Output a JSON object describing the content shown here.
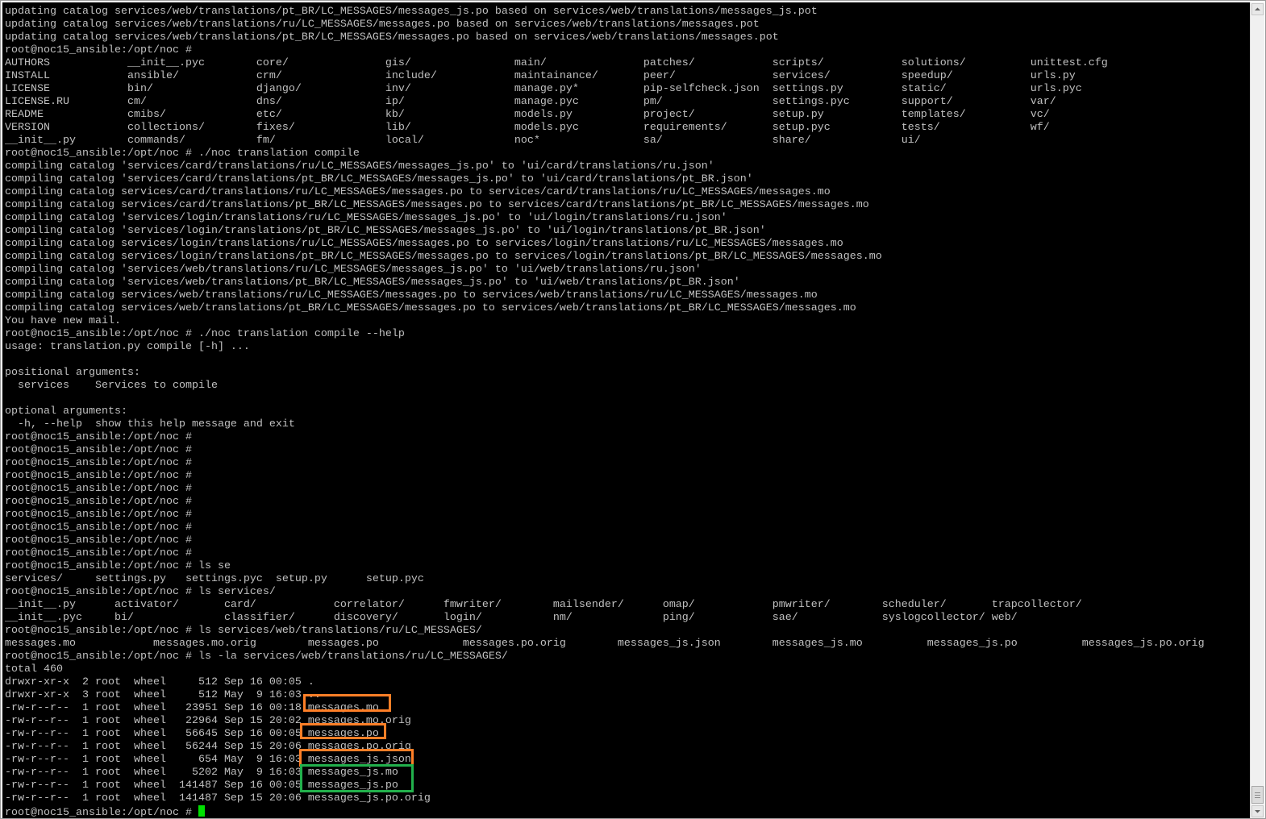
{
  "terminal": {
    "lines": [
      "updating catalog services/web/translations/pt_BR/LC_MESSAGES/messages_js.po based on services/web/translations/messages_js.pot",
      "updating catalog services/web/translations/ru/LC_MESSAGES/messages.po based on services/web/translations/messages.pot",
      "updating catalog services/web/translations/pt_BR/LC_MESSAGES/messages.po based on services/web/translations/messages.pot",
      "root@noc15_ansible:/opt/noc #",
      "AUTHORS            __init__.pyc        core/               gis/                main/               patches/            scripts/            solutions/          unittest.cfg",
      "INSTALL            ansible/            crm/                include/            maintainance/       peer/               services/           speedup/            urls.py",
      "LICENSE            bin/                django/             inv/                manage.py*          pip-selfcheck.json  settings.py         static/             urls.pyc",
      "LICENSE.RU         cm/                 dns/                ip/                 manage.pyc          pm/                 settings.pyc        support/            var/",
      "README             cmibs/              etc/                kb/                 models.py           project/            setup.py            templates/          vc/",
      "VERSION            collections/        fixes/              lib/                models.pyc          requirements/       setup.pyc           tests/              wf/",
      "__init__.py        commands/           fm/                 local/              noc*                sa/                 share/              ui/",
      "root@noc15_ansible:/opt/noc # ./noc translation compile",
      "compiling catalog 'services/card/translations/ru/LC_MESSAGES/messages_js.po' to 'ui/card/translations/ru.json'",
      "compiling catalog 'services/card/translations/pt_BR/LC_MESSAGES/messages_js.po' to 'ui/card/translations/pt_BR.json'",
      "compiling catalog services/card/translations/ru/LC_MESSAGES/messages.po to services/card/translations/ru/LC_MESSAGES/messages.mo",
      "compiling catalog services/card/translations/pt_BR/LC_MESSAGES/messages.po to services/card/translations/pt_BR/LC_MESSAGES/messages.mo",
      "compiling catalog 'services/login/translations/ru/LC_MESSAGES/messages_js.po' to 'ui/login/translations/ru.json'",
      "compiling catalog 'services/login/translations/pt_BR/LC_MESSAGES/messages_js.po' to 'ui/login/translations/pt_BR.json'",
      "compiling catalog services/login/translations/ru/LC_MESSAGES/messages.po to services/login/translations/ru/LC_MESSAGES/messages.mo",
      "compiling catalog services/login/translations/pt_BR/LC_MESSAGES/messages.po to services/login/translations/pt_BR/LC_MESSAGES/messages.mo",
      "compiling catalog 'services/web/translations/ru/LC_MESSAGES/messages_js.po' to 'ui/web/translations/ru.json'",
      "compiling catalog 'services/web/translations/pt_BR/LC_MESSAGES/messages_js.po' to 'ui/web/translations/pt_BR.json'",
      "compiling catalog services/web/translations/ru/LC_MESSAGES/messages.po to services/web/translations/ru/LC_MESSAGES/messages.mo",
      "compiling catalog services/web/translations/pt_BR/LC_MESSAGES/messages.po to services/web/translations/pt_BR/LC_MESSAGES/messages.mo",
      "You have new mail.",
      "root@noc15_ansible:/opt/noc # ./noc translation compile --help",
      "usage: translation.py compile [-h] ...",
      "",
      "positional arguments:",
      "  services    Services to compile",
      "",
      "optional arguments:",
      "  -h, --help  show this help message and exit",
      "root@noc15_ansible:/opt/noc #",
      "root@noc15_ansible:/opt/noc #",
      "root@noc15_ansible:/opt/noc #",
      "root@noc15_ansible:/opt/noc #",
      "root@noc15_ansible:/opt/noc #",
      "root@noc15_ansible:/opt/noc #",
      "root@noc15_ansible:/opt/noc #",
      "root@noc15_ansible:/opt/noc #",
      "root@noc15_ansible:/opt/noc #",
      "root@noc15_ansible:/opt/noc #",
      "root@noc15_ansible:/opt/noc # ls se",
      "services/     settings.py   settings.pyc  setup.py      setup.pyc",
      "root@noc15_ansible:/opt/noc # ls services/",
      "__init__.py      activator/       card/            correlator/      fmwriter/        mailsender/      omap/            pmwriter/        scheduler/       trapcollector/",
      "__init__.pyc     bi/              classifier/      discovery/       login/           nm/              ping/            sae/             syslogcollector/ web/",
      "root@noc15_ansible:/opt/noc # ls services/web/translations/ru/LC_MESSAGES/",
      "messages.mo            messages.mo.orig        messages.po             messages.po.orig        messages_js.json        messages_js.mo          messages_js.po          messages_js.po.orig",
      "root@noc15_ansible:/opt/noc # ls -la services/web/translations/ru/LC_MESSAGES/",
      "total 460",
      "drwxr-xr-x  2 root  wheel     512 Sep 16 00:05 .",
      "drwxr-xr-x  3 root  wheel     512 May  9 16:03 ..",
      "-rw-r--r--  1 root  wheel   23951 Sep 16 00:18 messages.mo",
      "-rw-r--r--  1 root  wheel   22964 Sep 15 20:02 messages.mo.orig",
      "-rw-r--r--  1 root  wheel   56645 Sep 16 00:05 messages.po",
      "-rw-r--r--  1 root  wheel   56244 Sep 15 20:06 messages.po.orig",
      "-rw-r--r--  1 root  wheel     654 May  9 16:03 messages_js.json",
      "-rw-r--r--  1 root  wheel    5202 May  9 16:03 messages_js.mo",
      "-rw-r--r--  1 root  wheel  141487 Sep 16 00:05 messages_js.po",
      "-rw-r--r--  1 root  wheel  141487 Sep 15 20:06 messages_js.po.orig"
    ],
    "prompt": "root@noc15_ansible:/opt/noc # "
  },
  "colors": {
    "background": "#000000",
    "foreground": "#c0c0c0",
    "cursor": "#00e000",
    "highlight_orange": "#ff7f27",
    "highlight_green": "#22b14c"
  }
}
